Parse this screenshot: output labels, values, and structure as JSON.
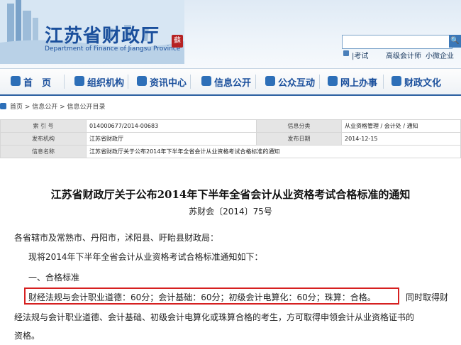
{
  "header": {
    "title": "江苏省财政厅",
    "subtitle": "Department of Finance of Jiangsu Province",
    "seal": "蘇",
    "search": {
      "value": "",
      "button": "🔍"
    },
    "quick_links": [
      "|考试",
      "高级会计师",
      "小微企业"
    ]
  },
  "nav": {
    "items": [
      "首　页",
      "组织机构",
      "资讯中心",
      "信息公开",
      "公众互动",
      "网上办事",
      "财政文化"
    ]
  },
  "breadcrumb": "首页 > 信息公开 > 信息公开目录",
  "info": {
    "index_label": "索 引 号",
    "index_value": "014000677/2014-00683",
    "category_label": "信息分类",
    "category_value": "从业资格管理 / 会计处 / 通知",
    "publisher_label": "发布机构",
    "publisher_value": "江苏省财政厅",
    "date_label": "发布日期",
    "date_value": "2014-12-15",
    "name_label": "信息名称",
    "name_value": "江苏省财政厅关于公布2014年下半年全省会计从业资格考试合格标准的通知"
  },
  "article": {
    "title": "江苏省财政厅关于公布2014年下半年全省会计从业资格考试合格标准的通知",
    "doc_no": "苏财会〔2014〕75号",
    "salutation": "各省辖市及常熟市、丹阳市，沭阳县、盱眙县财政局：",
    "intro": "现将2014年下半年全省会计从业资格考试合格标准通知如下：",
    "section": "一、合格标准",
    "line1_highlight": "财经法规与会计职业道德：60分；会计基础：60分；初级会计电算化：60分；珠算：合格。",
    "line1_rest": "同时取得财",
    "line2": "经法规与会计职业道德、会计基础、初级会计电算化或珠算合格的考生，方可取得申领会计从业资格证书的",
    "line3": "资格。"
  }
}
